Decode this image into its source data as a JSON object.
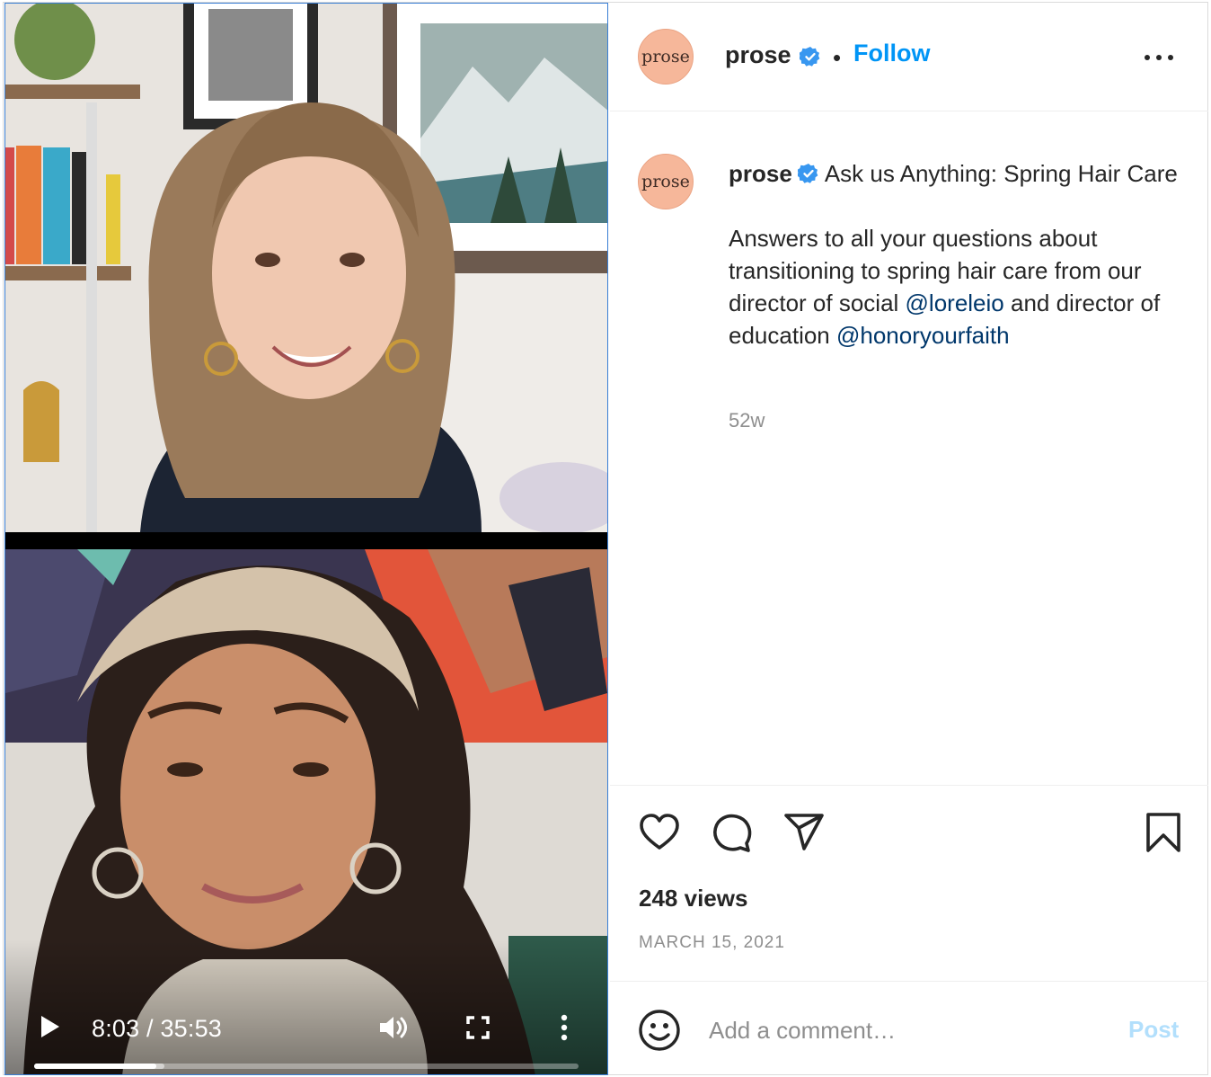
{
  "video": {
    "current_time": "8:03",
    "duration": "35:53",
    "time_display": "8:03 / 35:53",
    "progress_fraction": 0.224,
    "buffered_fraction": 0.24
  },
  "header": {
    "avatar_text": "prose",
    "username": "prose",
    "separator": "•",
    "follow_label": "Follow"
  },
  "caption": {
    "avatar_text": "prose",
    "username": "prose",
    "title": "Ask us Anything: Spring Hair Care",
    "body_before": "Answers to all your questions about transitioning to spring hair care from our director of social ",
    "mention_1": "@loreleio",
    "body_middle": " and director of education ",
    "mention_2": "@honoryourfaith",
    "age": "52w"
  },
  "stats": {
    "views": "248 views",
    "date": "MARCH 15, 2021"
  },
  "comment": {
    "placeholder": "Add a comment…",
    "post_label": "Post"
  },
  "colors": {
    "accent": "#0095f6",
    "verified": "#3897f0",
    "avatar_bg": "#f6b79a",
    "post_disabled": "#b2dffc"
  },
  "icons": [
    "play-icon",
    "volume-icon",
    "fullscreen-icon",
    "more-vertical-icon",
    "more-horizontal-icon",
    "verified-icon",
    "heart-icon",
    "comment-icon",
    "share-icon",
    "bookmark-icon",
    "emoji-icon"
  ]
}
